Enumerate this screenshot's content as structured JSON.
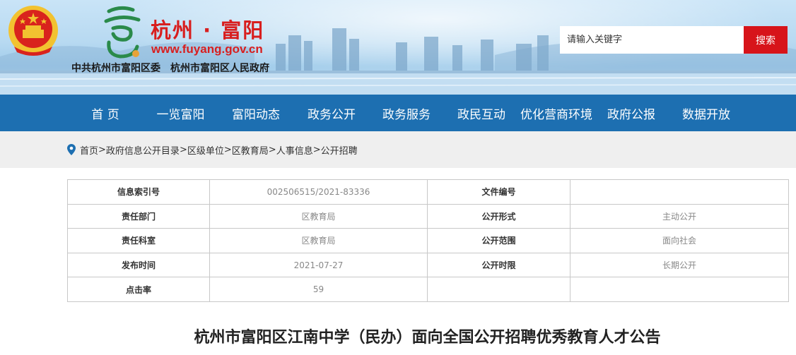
{
  "header": {
    "site_name": "杭州 · 富阳",
    "site_url": "www.fuyang.gov.cn",
    "org_primary": "中共杭州市富阳区委",
    "org_secondary": "杭州市富阳区人民政府",
    "search": {
      "placeholder": "请输入关键字",
      "button_label": "搜索"
    },
    "colors": {
      "brand_red": "#d81e1e",
      "search_button": "#d7141a"
    }
  },
  "nav": {
    "items": [
      {
        "label": "首 页"
      },
      {
        "label": "一览富阳"
      },
      {
        "label": "富阳动态"
      },
      {
        "label": "政务公开"
      },
      {
        "label": "政务服务"
      },
      {
        "label": "政民互动"
      },
      {
        "label": "优化营商环境"
      },
      {
        "label": "政府公报"
      },
      {
        "label": "数据开放"
      }
    ],
    "background": "#1d6fb1"
  },
  "breadcrumb": {
    "icon": "location-pin-icon",
    "items": [
      {
        "label": "首页"
      },
      {
        "label": "政府信息公开目录"
      },
      {
        "label": "区级单位"
      },
      {
        "label": "区教育局"
      },
      {
        "label": "人事信息"
      },
      {
        "label": "公开招聘"
      }
    ],
    "separator": ">"
  },
  "info": {
    "rows": [
      {
        "l1": "信息索引号",
        "v1": "002506515/2021-83336",
        "l2": "文件编号",
        "v2": ""
      },
      {
        "l1": "责任部门",
        "v1": "区教育局",
        "l2": "公开形式",
        "v2": "主动公开"
      },
      {
        "l1": "责任科室",
        "v1": "区教育局",
        "l2": "公开范围",
        "v2": "面向社会"
      },
      {
        "l1": "发布时间",
        "v1": "2021-07-27",
        "l2": "公开时限",
        "v2": "长期公开"
      },
      {
        "l1": "点击率",
        "v1": "59",
        "l2": "",
        "v2": ""
      }
    ]
  },
  "article": {
    "title": "杭州市富阳区江南中学（民办）面向全国公开招聘优秀教育人才公告"
  }
}
